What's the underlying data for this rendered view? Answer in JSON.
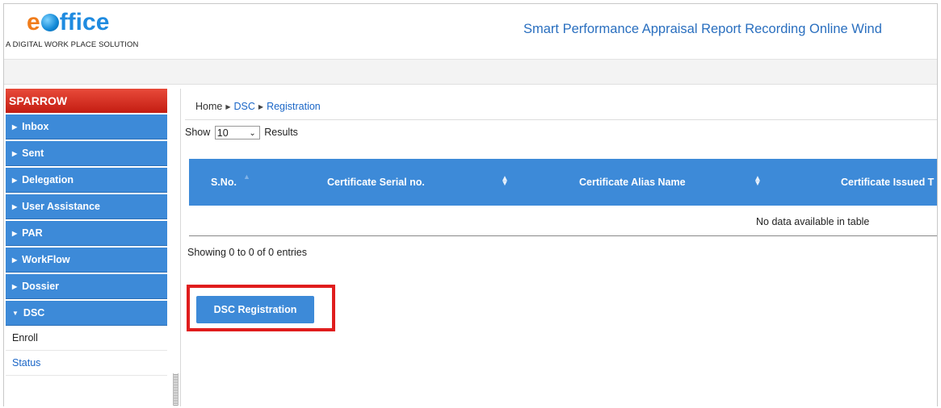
{
  "header": {
    "logo_e": "e",
    "logo_rest": "ffice",
    "tagline": "A DIGITAL WORK PLACE SOLUTION",
    "app_title": "Smart Performance Appraisal Report Recording Online Wind"
  },
  "sidebar": {
    "brand": "SPARROW",
    "items": [
      {
        "label": "Inbox",
        "icon": "caret-right-icon"
      },
      {
        "label": "Sent",
        "icon": "caret-right-icon"
      },
      {
        "label": "Delegation",
        "icon": "caret-right-icon"
      },
      {
        "label": "User Assistance",
        "icon": "caret-right-icon"
      },
      {
        "label": "PAR",
        "icon": "caret-right-icon"
      },
      {
        "label": "WorkFlow",
        "icon": "caret-right-icon"
      },
      {
        "label": "Dossier",
        "icon": "caret-right-icon"
      },
      {
        "label": "DSC",
        "icon": "caret-down-icon",
        "expanded": true
      }
    ],
    "subitems": [
      "Enroll",
      "Status"
    ]
  },
  "breadcrumb": {
    "home": "Home",
    "dsc": "DSC",
    "registration": "Registration"
  },
  "table_controls": {
    "show_label": "Show",
    "page_size": "10",
    "results_label": "Results"
  },
  "table": {
    "columns": [
      "S.No.",
      "Certificate Serial no.",
      "Certificate Alias Name",
      "Certificate Issued T"
    ],
    "empty_message": "No data available in table",
    "info": "Showing 0 to 0 of 0 entries"
  },
  "actions": {
    "dsc_registration_label": "DSC Registration"
  },
  "colors": {
    "accent_blue": "#3d8ad8",
    "brand_red": "#c41d12",
    "highlight_red": "#e01d1d",
    "link_blue": "#1a66c7"
  }
}
